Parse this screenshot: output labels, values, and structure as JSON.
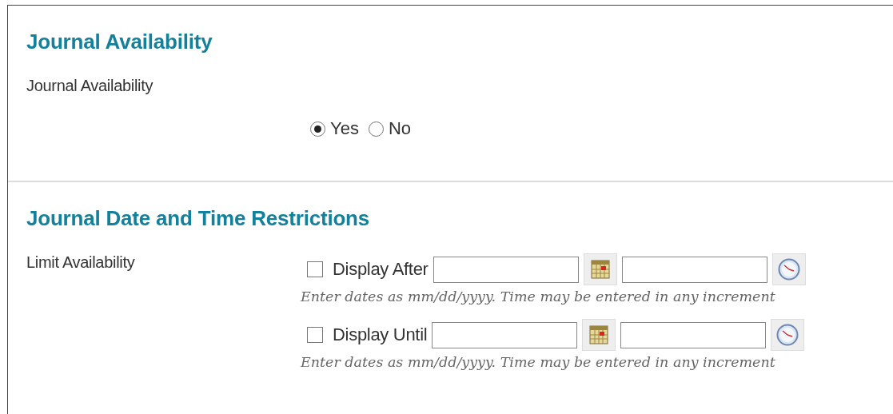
{
  "sections": [
    {
      "title": "Journal Availability",
      "rows": [
        {
          "label": "Journal Availability",
          "kind": "radio",
          "options": [
            {
              "label": "Yes",
              "selected": true
            },
            {
              "label": "No",
              "selected": false
            }
          ]
        }
      ]
    },
    {
      "title": "Journal Date and Time Restrictions",
      "rows": [
        {
          "label": "Limit Availability",
          "kind": "dates",
          "items": [
            {
              "label": "Display After",
              "checked": false,
              "hint": "Enter dates as mm/dd/yyyy. Time may be entered in any increment"
            },
            {
              "label": "Display Until",
              "checked": false,
              "hint": "Enter dates as mm/dd/yyyy. Time may be entered in any increment"
            }
          ]
        }
      ]
    }
  ]
}
